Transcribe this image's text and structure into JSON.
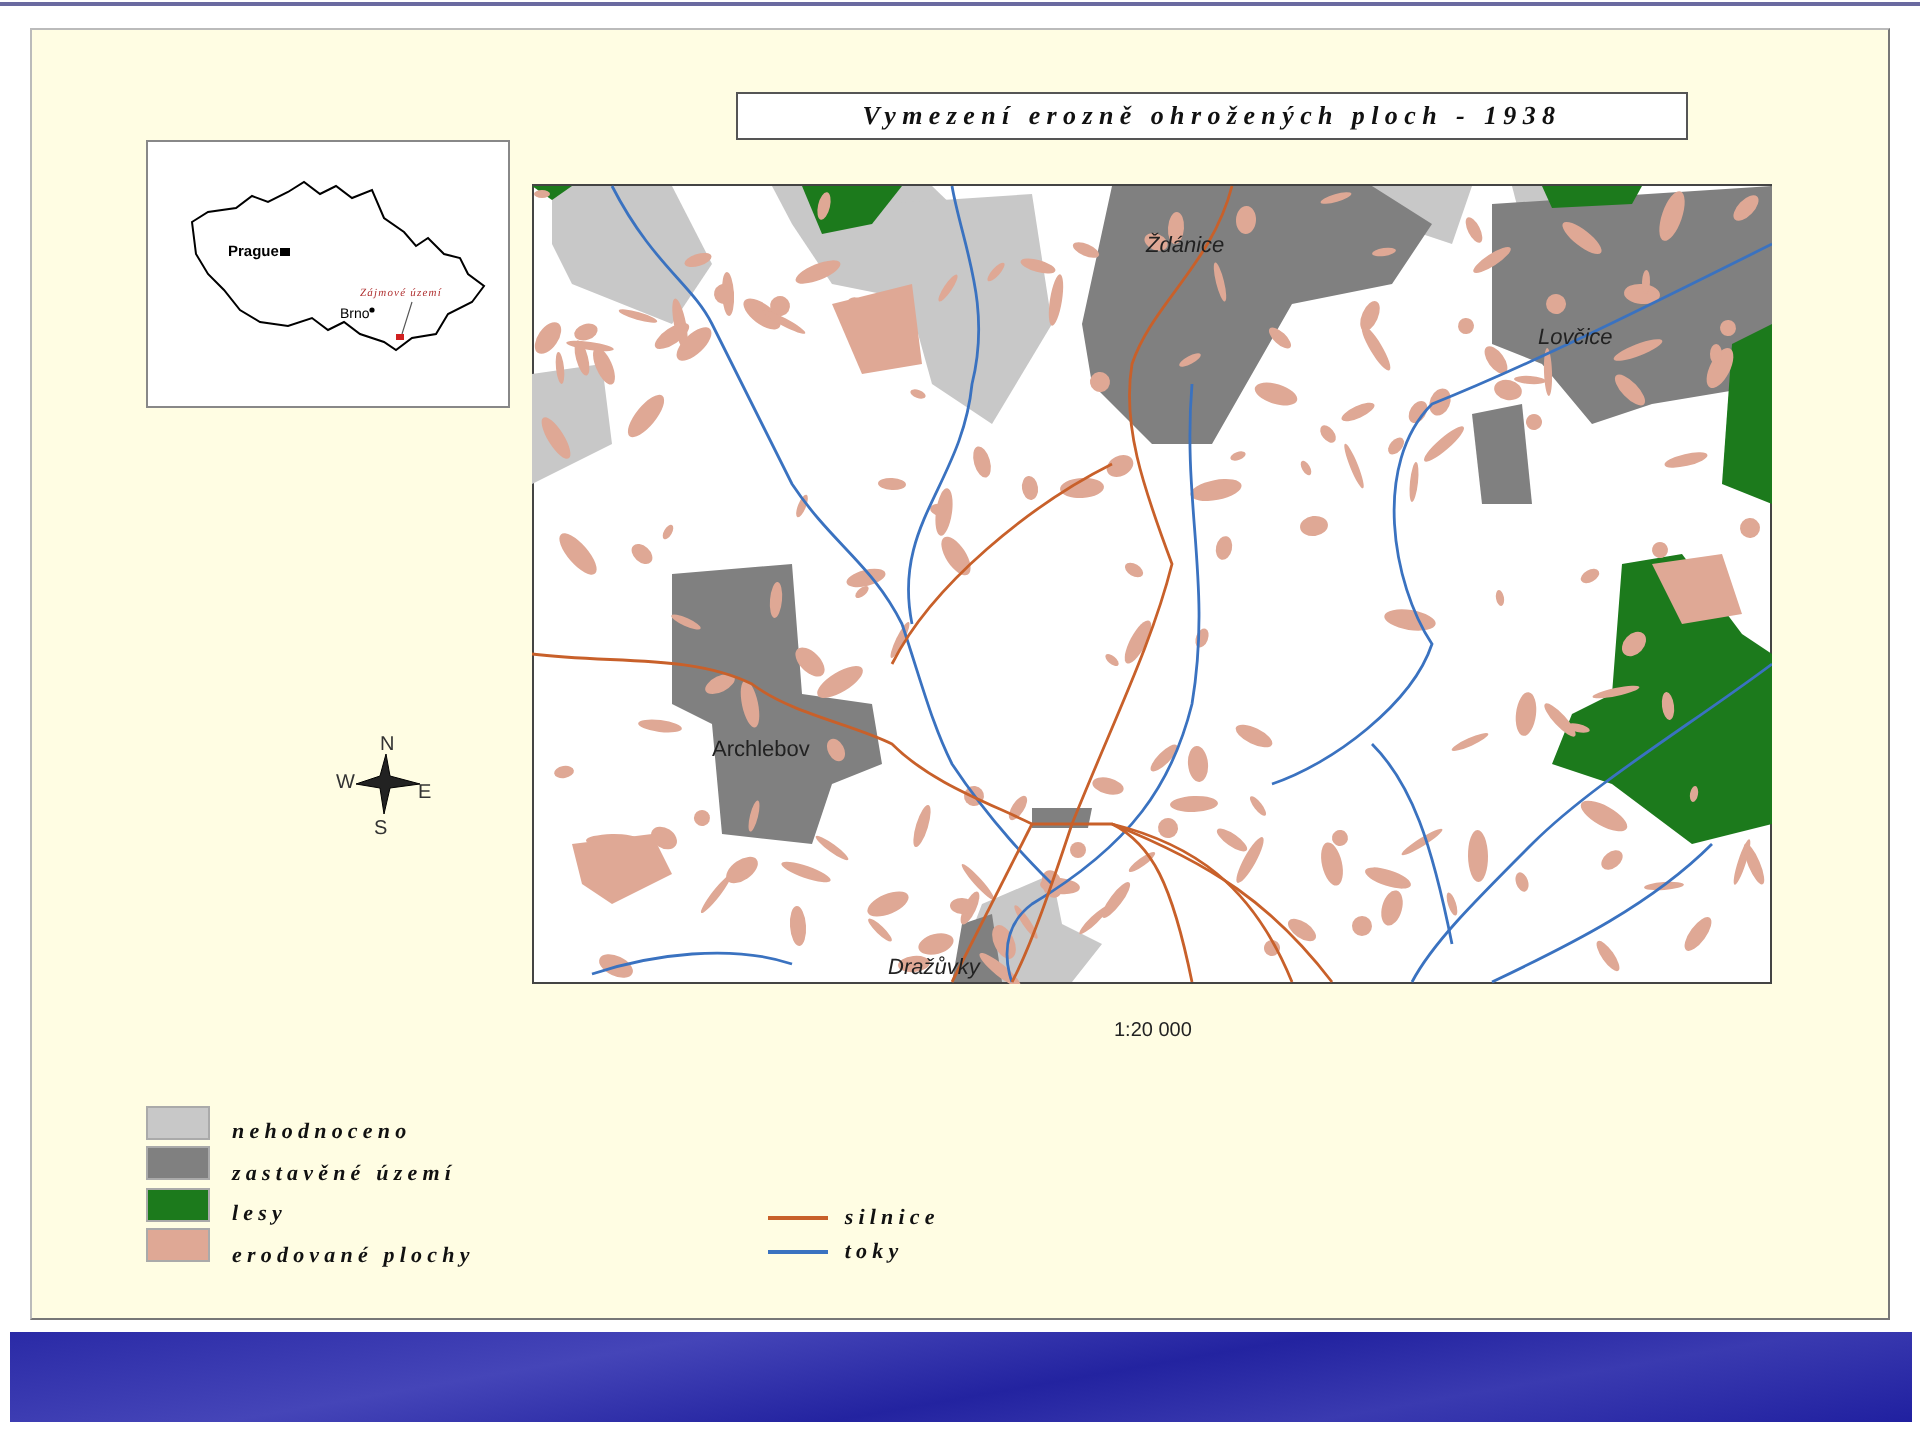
{
  "title": "Vymezení erozně ohrožených ploch - 1938",
  "inset": {
    "cities": [
      {
        "label": "Prague"
      },
      {
        "label": "Brno"
      }
    ],
    "area_label": "Zájmové území"
  },
  "compass": {
    "north": "N",
    "west": "W",
    "east": "E",
    "south": "S"
  },
  "map": {
    "places": [
      {
        "label": "Ždánice",
        "italic": true
      },
      {
        "label": "Lovčice",
        "italic": true
      },
      {
        "label": "Archlebov",
        "italic": false
      },
      {
        "label": "Dražůvky",
        "italic": true
      }
    ]
  },
  "scale": "1:20 000",
  "legend": [
    {
      "label": "nehodnoceno",
      "kind": "area",
      "color": "#c8c8c8"
    },
    {
      "label": "zastavěné území",
      "kind": "area",
      "color": "#808080"
    },
    {
      "label": "lesy",
      "kind": "area",
      "color": "#1c7a1c"
    },
    {
      "label": "erodované plochy",
      "kind": "area",
      "color": "#dfa895"
    },
    {
      "label": "silnice",
      "kind": "line",
      "color": "#c8602a"
    },
    {
      "label": "toky",
      "kind": "line",
      "color": "#3a72c0"
    }
  ]
}
